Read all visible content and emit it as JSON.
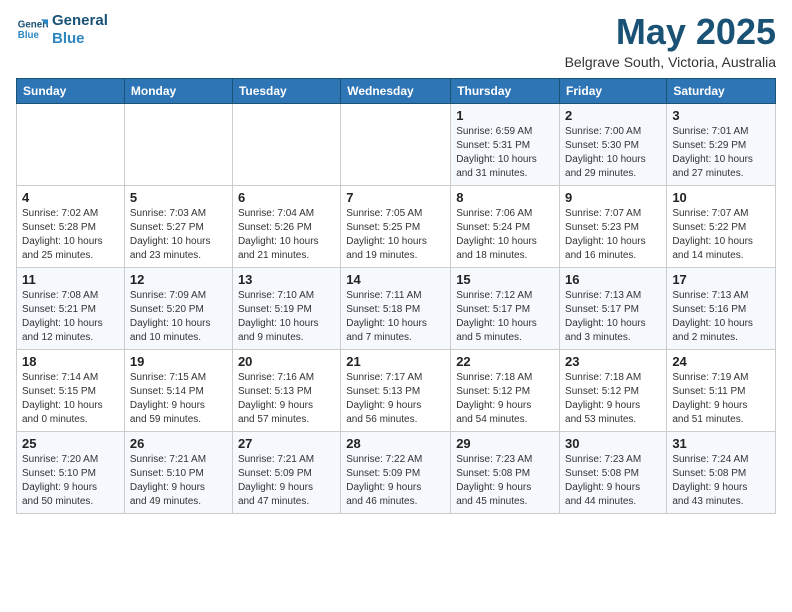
{
  "header": {
    "logo_line1": "General",
    "logo_line2": "Blue",
    "month_title": "May 2025",
    "location": "Belgrave South, Victoria, Australia"
  },
  "weekdays": [
    "Sunday",
    "Monday",
    "Tuesday",
    "Wednesday",
    "Thursday",
    "Friday",
    "Saturday"
  ],
  "weeks": [
    [
      {
        "date": "",
        "info": ""
      },
      {
        "date": "",
        "info": ""
      },
      {
        "date": "",
        "info": ""
      },
      {
        "date": "",
        "info": ""
      },
      {
        "date": "1",
        "info": "Sunrise: 6:59 AM\nSunset: 5:31 PM\nDaylight: 10 hours\nand 31 minutes."
      },
      {
        "date": "2",
        "info": "Sunrise: 7:00 AM\nSunset: 5:30 PM\nDaylight: 10 hours\nand 29 minutes."
      },
      {
        "date": "3",
        "info": "Sunrise: 7:01 AM\nSunset: 5:29 PM\nDaylight: 10 hours\nand 27 minutes."
      }
    ],
    [
      {
        "date": "4",
        "info": "Sunrise: 7:02 AM\nSunset: 5:28 PM\nDaylight: 10 hours\nand 25 minutes."
      },
      {
        "date": "5",
        "info": "Sunrise: 7:03 AM\nSunset: 5:27 PM\nDaylight: 10 hours\nand 23 minutes."
      },
      {
        "date": "6",
        "info": "Sunrise: 7:04 AM\nSunset: 5:26 PM\nDaylight: 10 hours\nand 21 minutes."
      },
      {
        "date": "7",
        "info": "Sunrise: 7:05 AM\nSunset: 5:25 PM\nDaylight: 10 hours\nand 19 minutes."
      },
      {
        "date": "8",
        "info": "Sunrise: 7:06 AM\nSunset: 5:24 PM\nDaylight: 10 hours\nand 18 minutes."
      },
      {
        "date": "9",
        "info": "Sunrise: 7:07 AM\nSunset: 5:23 PM\nDaylight: 10 hours\nand 16 minutes."
      },
      {
        "date": "10",
        "info": "Sunrise: 7:07 AM\nSunset: 5:22 PM\nDaylight: 10 hours\nand 14 minutes."
      }
    ],
    [
      {
        "date": "11",
        "info": "Sunrise: 7:08 AM\nSunset: 5:21 PM\nDaylight: 10 hours\nand 12 minutes."
      },
      {
        "date": "12",
        "info": "Sunrise: 7:09 AM\nSunset: 5:20 PM\nDaylight: 10 hours\nand 10 minutes."
      },
      {
        "date": "13",
        "info": "Sunrise: 7:10 AM\nSunset: 5:19 PM\nDaylight: 10 hours\nand 9 minutes."
      },
      {
        "date": "14",
        "info": "Sunrise: 7:11 AM\nSunset: 5:18 PM\nDaylight: 10 hours\nand 7 minutes."
      },
      {
        "date": "15",
        "info": "Sunrise: 7:12 AM\nSunset: 5:17 PM\nDaylight: 10 hours\nand 5 minutes."
      },
      {
        "date": "16",
        "info": "Sunrise: 7:13 AM\nSunset: 5:17 PM\nDaylight: 10 hours\nand 3 minutes."
      },
      {
        "date": "17",
        "info": "Sunrise: 7:13 AM\nSunset: 5:16 PM\nDaylight: 10 hours\nand 2 minutes."
      }
    ],
    [
      {
        "date": "18",
        "info": "Sunrise: 7:14 AM\nSunset: 5:15 PM\nDaylight: 10 hours\nand 0 minutes."
      },
      {
        "date": "19",
        "info": "Sunrise: 7:15 AM\nSunset: 5:14 PM\nDaylight: 9 hours\nand 59 minutes."
      },
      {
        "date": "20",
        "info": "Sunrise: 7:16 AM\nSunset: 5:13 PM\nDaylight: 9 hours\nand 57 minutes."
      },
      {
        "date": "21",
        "info": "Sunrise: 7:17 AM\nSunset: 5:13 PM\nDaylight: 9 hours\nand 56 minutes."
      },
      {
        "date": "22",
        "info": "Sunrise: 7:18 AM\nSunset: 5:12 PM\nDaylight: 9 hours\nand 54 minutes."
      },
      {
        "date": "23",
        "info": "Sunrise: 7:18 AM\nSunset: 5:12 PM\nDaylight: 9 hours\nand 53 minutes."
      },
      {
        "date": "24",
        "info": "Sunrise: 7:19 AM\nSunset: 5:11 PM\nDaylight: 9 hours\nand 51 minutes."
      }
    ],
    [
      {
        "date": "25",
        "info": "Sunrise: 7:20 AM\nSunset: 5:10 PM\nDaylight: 9 hours\nand 50 minutes."
      },
      {
        "date": "26",
        "info": "Sunrise: 7:21 AM\nSunset: 5:10 PM\nDaylight: 9 hours\nand 49 minutes."
      },
      {
        "date": "27",
        "info": "Sunrise: 7:21 AM\nSunset: 5:09 PM\nDaylight: 9 hours\nand 47 minutes."
      },
      {
        "date": "28",
        "info": "Sunrise: 7:22 AM\nSunset: 5:09 PM\nDaylight: 9 hours\nand 46 minutes."
      },
      {
        "date": "29",
        "info": "Sunrise: 7:23 AM\nSunset: 5:08 PM\nDaylight: 9 hours\nand 45 minutes."
      },
      {
        "date": "30",
        "info": "Sunrise: 7:23 AM\nSunset: 5:08 PM\nDaylight: 9 hours\nand 44 minutes."
      },
      {
        "date": "31",
        "info": "Sunrise: 7:24 AM\nSunset: 5:08 PM\nDaylight: 9 hours\nand 43 minutes."
      }
    ]
  ]
}
